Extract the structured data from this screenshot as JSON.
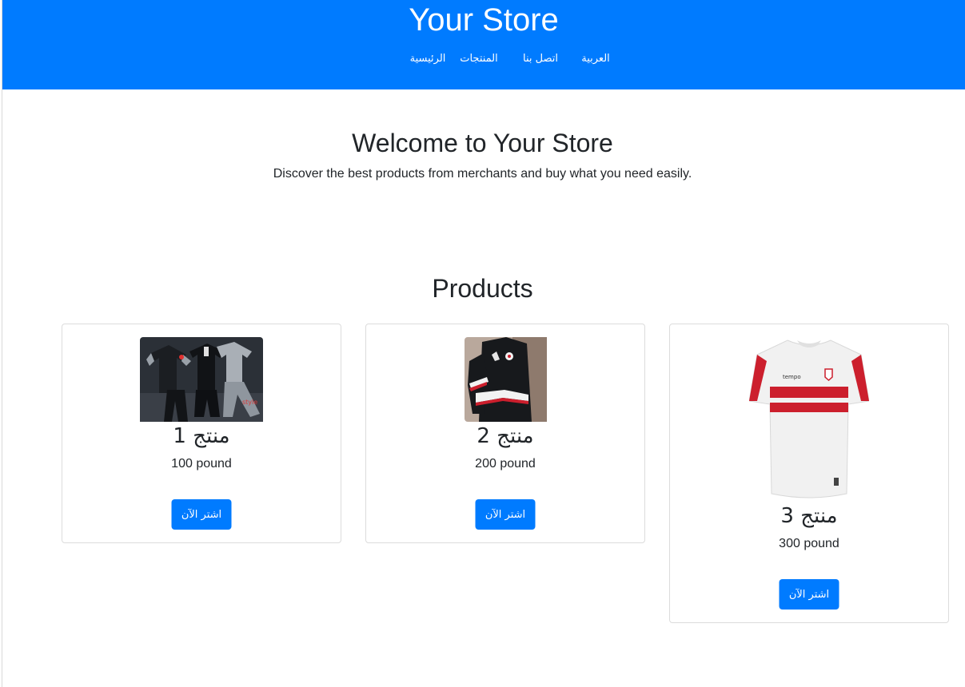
{
  "header": {
    "title": "Your Store",
    "nav": [
      "العربية",
      "اتصل بنا",
      "المنتجات",
      "الرئيسية"
    ]
  },
  "hero": {
    "title": "Welcome to Your Store",
    "subtitle": "Discover the best products from merchants and buy what you need easily."
  },
  "products": {
    "title": "Products",
    "items": [
      {
        "name": "منتج 1",
        "price": "100 pound",
        "button": "اشتر الآن",
        "image": "tracksuit-image"
      },
      {
        "name": "منتج 2",
        "price": "200 pound",
        "button": "اشتر الآن",
        "image": "jacket-image"
      },
      {
        "name": "منتج 3",
        "price": "300 pound",
        "button": "اشتر الآن",
        "image": "jersey-image"
      }
    ]
  },
  "colors": {
    "primary": "#007bff",
    "jersey_stripe": "#cc1f2d"
  }
}
